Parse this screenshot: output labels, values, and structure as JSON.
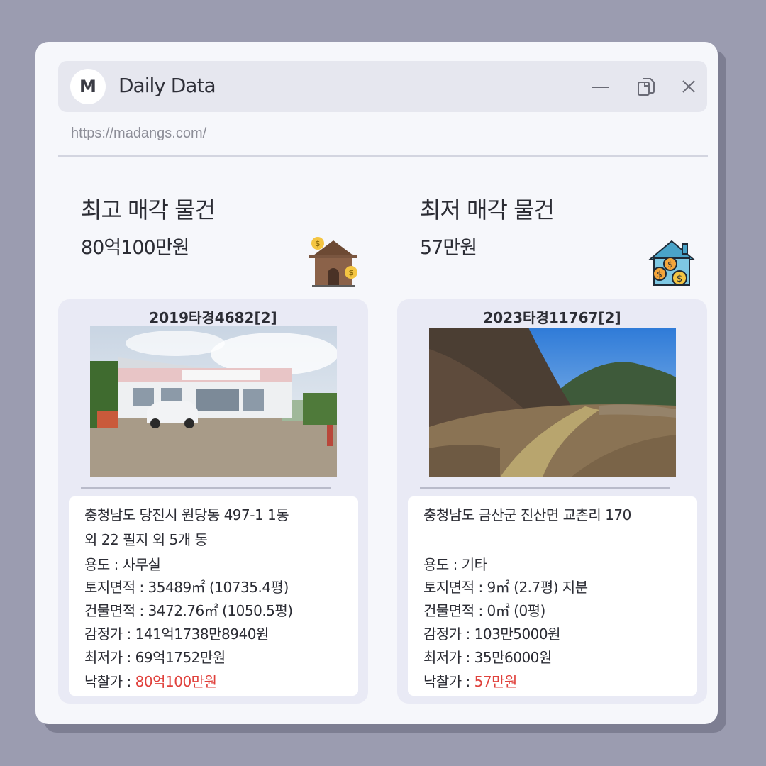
{
  "app": {
    "logo_letter": "M",
    "title": "Daily Data",
    "url": "https://madangs.com/"
  },
  "highest": {
    "heading": "최고 매각 물건",
    "price": "80억100만원",
    "case_no": "2019타경4682[2]",
    "address_line1": "충청남도 당진시 원당동 497-1 1동",
    "address_line2": "외 22 필지 외 5개 동",
    "usage": "용도 : 사무실",
    "land_area": "토지면적 : 35489㎡ (10735.4평)",
    "building_area": "건물면적 : 3472.76㎡ (1050.5평)",
    "appraisal": "감정가 : 141억1738만8940원",
    "minimum": "최저가 : 69억1752만원",
    "winning_label": "낙찰가 : ",
    "winning_value": "80억100만원"
  },
  "lowest": {
    "heading": "최저 매각 물건",
    "price": "57만원",
    "case_no": "2023타경11767[2]",
    "address_line1": "충청남도 금산군 진산면 교촌리 170",
    "usage": "용도 : 기타",
    "land_area": "토지면적 : 9㎡ (2.7평) 지분",
    "building_area": "건물면적 : 0㎡ (0평)",
    "appraisal": "감정가 :  103만5000원",
    "minimum": "최저가 : 35만6000원",
    "winning_label": "낙찰가 : ",
    "winning_value": "57만원"
  },
  "icons": {
    "minimize": "minimize-icon",
    "restore": "restore-icon",
    "close": "close-icon",
    "left_badge": "house-dollar-icon",
    "right_badge": "house-investment-icon"
  },
  "colors": {
    "accent_red": "#e0413c",
    "background": "#9b9cb0",
    "window": "#f6f7fb",
    "card": "#e9eaf5"
  }
}
